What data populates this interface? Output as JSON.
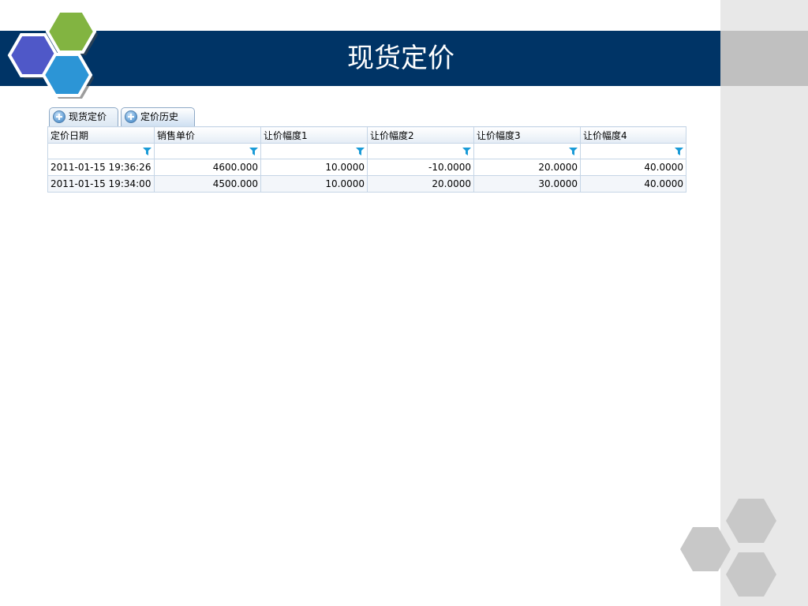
{
  "title": "现货定价",
  "tabs": [
    {
      "label": "现货定价",
      "icon": "snowflake-icon"
    },
    {
      "label": "定价历史",
      "icon": "snowflake-icon"
    }
  ],
  "grid": {
    "columns": [
      "定价日期",
      "销售单价",
      "让价幅度1",
      "让价幅度2",
      "让价幅度3",
      "让价幅度4"
    ],
    "rows": [
      [
        "2011-01-15 19:36:26",
        "4600.000",
        "10.0000",
        "-10.0000",
        "20.0000",
        "40.0000"
      ],
      [
        "2011-01-15 19:34:00",
        "4500.000",
        "10.0000",
        "20.0000",
        "30.0000",
        "40.0000"
      ]
    ],
    "filter_icon": "filter-icon"
  },
  "colors": {
    "title_bar": "#003466",
    "hex_green": "#82b441",
    "hex_blue": "#2c95d6",
    "hex_purple": "#4f58c8",
    "accent_filter": "#1a9bd7"
  }
}
